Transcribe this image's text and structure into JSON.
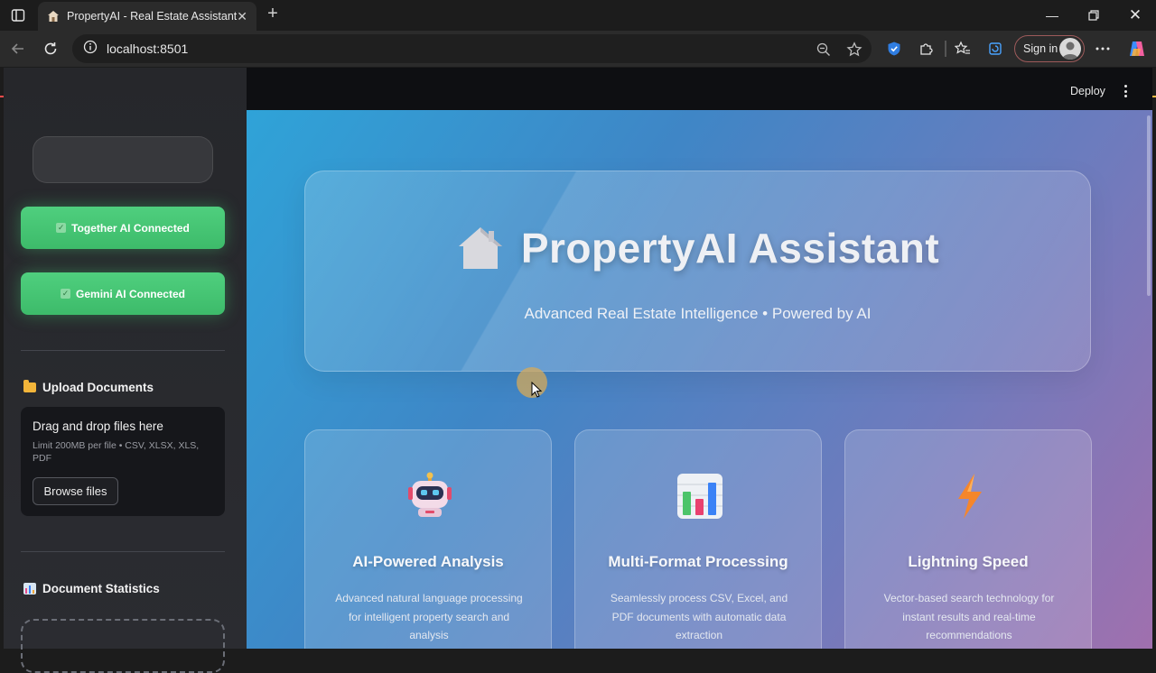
{
  "browser": {
    "tab_title": "PropertyAI - Real Estate Assistant",
    "url": "localhost:8501",
    "signin_label": "Sign in"
  },
  "sidebar": {
    "status": [
      {
        "label": "Together AI Connected"
      },
      {
        "label": "Gemini AI Connected"
      }
    ],
    "upload": {
      "heading": "Upload Documents",
      "drop_title": "Drag and drop files here",
      "limit": "Limit 200MB per file • CSV, XLSX, XLS, PDF",
      "browse_label": "Browse files"
    },
    "stats_heading": "Document Statistics"
  },
  "header": {
    "deploy_label": "Deploy"
  },
  "hero": {
    "title": "PropertyAI Assistant",
    "subtitle": "Advanced Real Estate Intelligence • Powered by AI"
  },
  "features": [
    {
      "icon": "robot-icon",
      "title": "AI-Powered Analysis",
      "desc": "Advanced natural language processing for intelligent property search and analysis"
    },
    {
      "icon": "bar-chart-icon",
      "title": "Multi-Format Processing",
      "desc": "Seamlessly process CSV, Excel, and PDF documents with automatic data extraction"
    },
    {
      "icon": "lightning-icon",
      "title": "Lightning Speed",
      "desc": "Vector-based search technology for instant results and real-time recommendations"
    }
  ],
  "colors": {
    "status_green": "#3dbb6a",
    "accent_red": "#ff4b4b",
    "main_gradient_start": "#2fa3d8",
    "main_gradient_end": "#a070ae"
  }
}
